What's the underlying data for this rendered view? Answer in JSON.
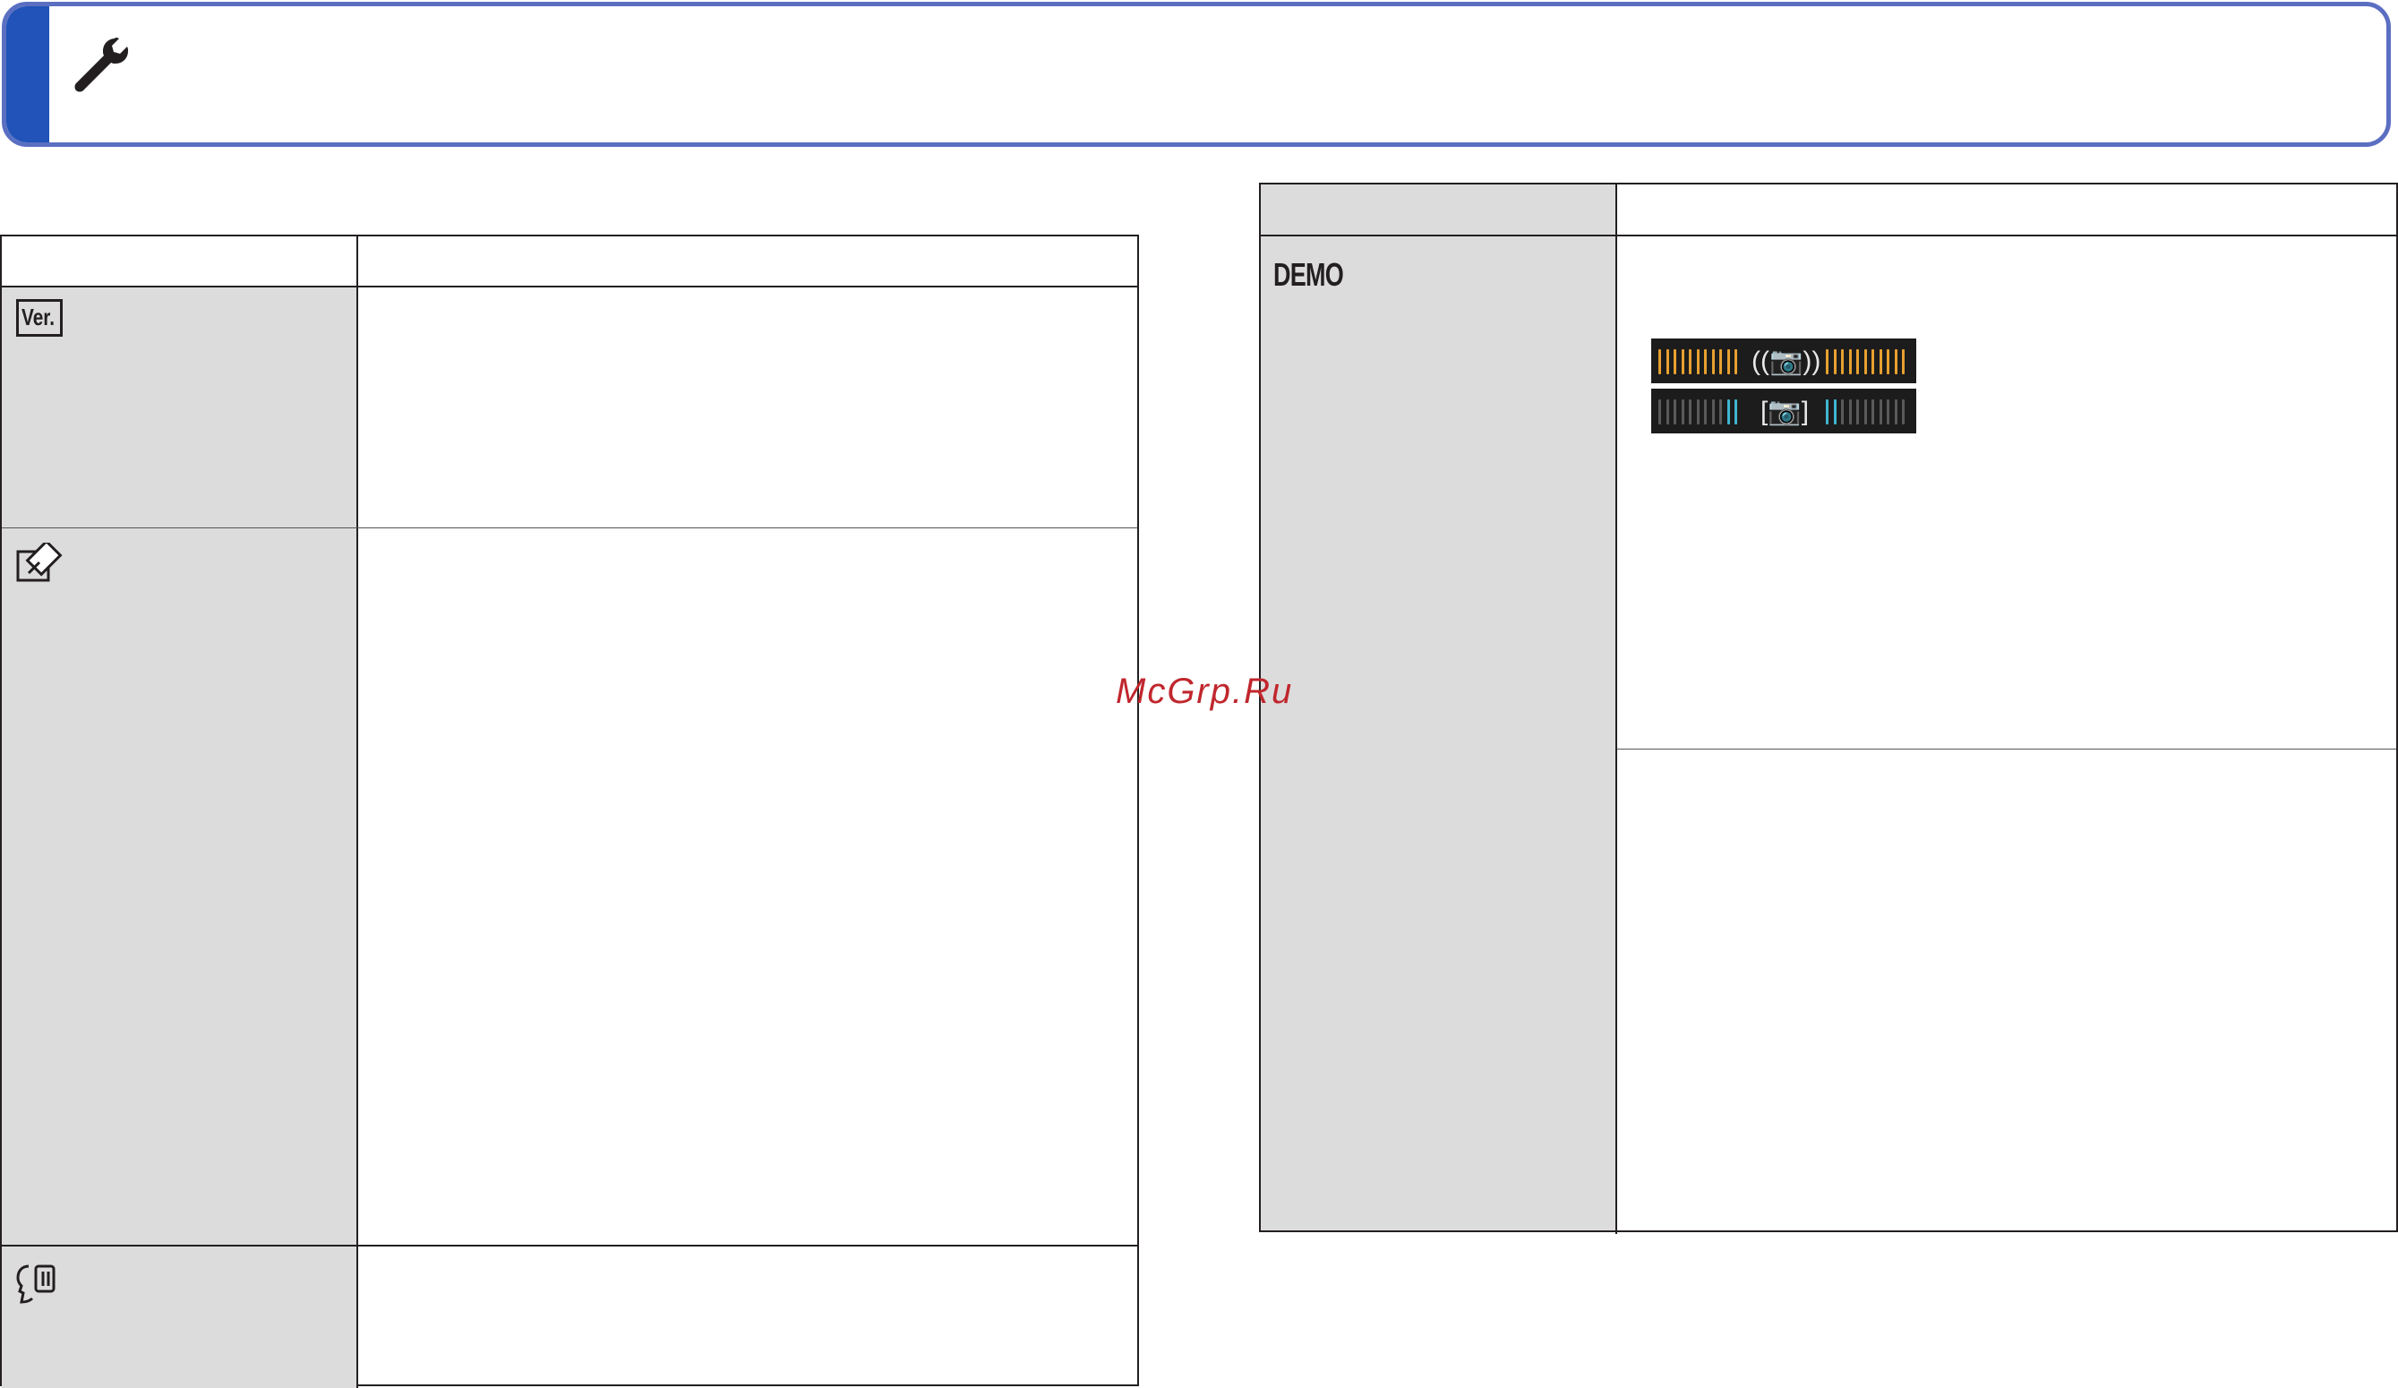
{
  "header": {
    "icon": "wrench-icon",
    "title": "",
    "accent_color": "#2153b8",
    "border_color": "#5b6fc2"
  },
  "left_table": {
    "column_headers": [
      "",
      ""
    ],
    "rows": [
      {
        "icon": "version-display-icon",
        "icon_text": "Ver.",
        "label": "",
        "description": ""
      },
      {
        "icon": "format-icon",
        "label": "",
        "description": ""
      },
      {
        "icon": "voice-guidance-icon",
        "label": "",
        "description": ""
      }
    ]
  },
  "right_table": {
    "column_headers": [
      "",
      ""
    ],
    "rows": [
      {
        "label": "DEMO",
        "description_top": "",
        "description_bottom": ""
      }
    ],
    "meter_colors": {
      "stabilizer": "#e8a030",
      "subject": "#3fb6d0",
      "idle": "#5a5a5a"
    }
  },
  "watermark": {
    "text": "McGrp.Ru",
    "color": "#c0272d"
  }
}
